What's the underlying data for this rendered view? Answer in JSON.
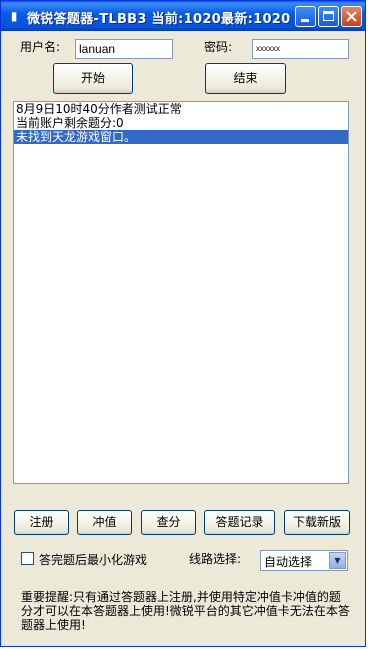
{
  "window": {
    "title": "微锐答题器-TLBB3 当前:1020最新:1020",
    "icons": [
      "app-icon",
      "minimize-icon",
      "maximize-icon",
      "close-icon"
    ]
  },
  "login": {
    "username_label": "用户名:",
    "username_value": "lanuan",
    "password_label": "密码:",
    "password_value": "xxxxxx"
  },
  "actions": {
    "start_label": "开始",
    "stop_label": "结束"
  },
  "log": {
    "lines": [
      "8月9日10时40分作者测试正常",
      "当前账户剩余题分:0",
      "未找到天龙游戏窗口。"
    ],
    "selected_index": 2
  },
  "bottom_buttons": {
    "register": "注册",
    "recharge": "冲值",
    "query": "查分",
    "records": "答题记录",
    "download": "下载新版"
  },
  "options": {
    "minimize_label": "答完题后最小化游戏",
    "minimize_checked": false,
    "route_label": "线路选择:",
    "route_value": "自动选择"
  },
  "notice": "重要提醒:只有通过答题器上注册,并使用特定冲值卡冲值的题分才可以在本答题器上使用!微锐平台的其它冲值卡无法在本答题器上使用!",
  "colors": {
    "titlebar": "#0a5ce6",
    "selection": "#316ac5",
    "window_bg": "#ece9d8"
  }
}
